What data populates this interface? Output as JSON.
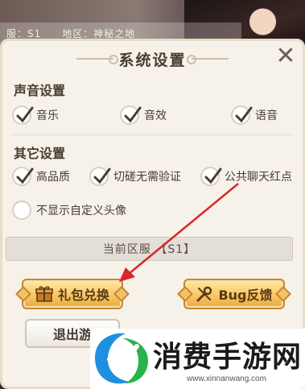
{
  "header": {
    "server_text": "服：S1",
    "region_text": "地区：神秘之地"
  },
  "dialog": {
    "title": "系统设置",
    "close_label": "✕"
  },
  "sound": {
    "heading": "声音设置",
    "options": [
      {
        "label": "音乐",
        "checked": true
      },
      {
        "label": "音效",
        "checked": true
      },
      {
        "label": "语音",
        "checked": true
      }
    ]
  },
  "other": {
    "heading": "其它设置",
    "options": [
      {
        "label": "高品质",
        "checked": true
      },
      {
        "label": "切磋无需验证",
        "checked": true
      },
      {
        "label": "公共聊天红点",
        "checked": true
      },
      {
        "label": "不显示自定义头像",
        "checked": false
      }
    ]
  },
  "server_bar": {
    "label": "当前区服 【S1】"
  },
  "buttons": {
    "gift_code": "礼包兑换",
    "feedback": "Bug反馈",
    "exit": "退出游"
  },
  "colors": {
    "panel_bg": "#f6f2ea",
    "gold_button": "#f7c766",
    "annotation_arrow": "#d9252b",
    "text_dark": "#4a3b30"
  },
  "watermark": {
    "name": "消费手游网",
    "url": "www.xinnanwang.com"
  }
}
